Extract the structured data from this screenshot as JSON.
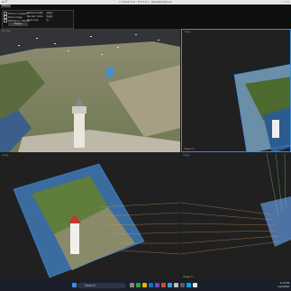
{
  "window": {
    "title": "[ model 0.0 - 3.3 3.0 ] - RealityCapture",
    "menu": "⊞  ☰",
    "controls": "–  ▢  ✕"
  },
  "panel": {
    "header": "Display",
    "options": [
      {
        "label": "Show in viewport",
        "checked": true
      },
      {
        "label": "Show image",
        "checked": false
      },
      {
        "label": "Reference: Default",
        "checked": true
      }
    ],
    "fields": [
      {
        "label": "Radius length",
        "value": "Auto"
      },
      {
        "label": "Render mode",
        "value": "Solid"
      },
      {
        "label": "Point size",
        "value": "1"
      }
    ],
    "apply_label": "Display"
  },
  "viewports": [
    {
      "title": "3D View",
      "label": ""
    },
    {
      "title": "Image",
      "label": "Image 2 ▾"
    },
    {
      "title": "Image",
      "label": ""
    },
    {
      "title": "Image",
      "label": "Image 3 ▾"
    }
  ],
  "taskbar": {
    "search_placeholder": "Search",
    "clock_time": "4:15 PM",
    "clock_date": "3/12/2024"
  },
  "colors": {
    "accent": "#3d8ee0",
    "taskbar": "#1a1f2b",
    "match_lines": "#d99a4a"
  }
}
